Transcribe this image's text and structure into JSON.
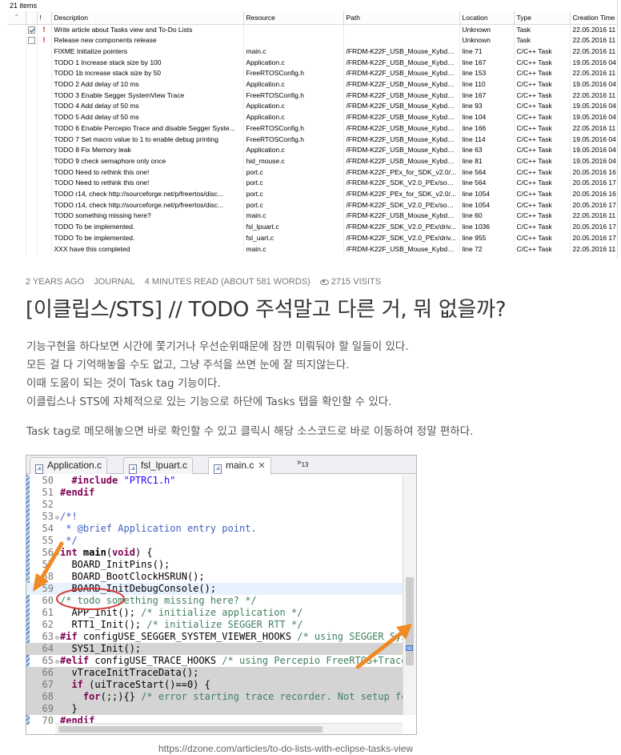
{
  "tasks_view": {
    "item_count": "21 items",
    "columns": [
      "Description",
      "Resource",
      "Path",
      "Location",
      "Type",
      "Creation Time"
    ],
    "rows": [
      {
        "checked": true,
        "priority": "!",
        "description": "Write article about Tasks view and To-Do Lists",
        "resource": "",
        "path": "",
        "location": "Unknown",
        "type": "Task",
        "created": "22.05.2016 11"
      },
      {
        "checked": false,
        "priority": "!",
        "description": "Release new components release",
        "resource": "",
        "path": "",
        "location": "Unknown",
        "type": "Task",
        "created": "22.05.2016 11"
      },
      {
        "checked": null,
        "priority": "",
        "description": "FIXME Initialize pointers",
        "resource": "main.c",
        "path": "/FRDM-K22F_USB_Mouse_Kybd_...",
        "location": "line 71",
        "type": "C/C++ Task",
        "created": "22.05.2016 11"
      },
      {
        "checked": null,
        "priority": "",
        "description": "TODO 1 Increase stack size by 100",
        "resource": "Application.c",
        "path": "/FRDM-K22F_USB_Mouse_Kybd_...",
        "location": "line 167",
        "type": "C/C++ Task",
        "created": "19.05.2016 04"
      },
      {
        "checked": null,
        "priority": "",
        "description": "TODO 1b increase stack size by 50",
        "resource": "FreeRTOSConfig.h",
        "path": "/FRDM-K22F_USB_Mouse_Kybd_...",
        "location": "line 153",
        "type": "C/C++ Task",
        "created": "22.05.2016 11"
      },
      {
        "checked": null,
        "priority": "",
        "description": "TODO 2 Add delay of 10 ms",
        "resource": "Application.c",
        "path": "/FRDM-K22F_USB_Mouse_Kybd_...",
        "location": "line 110",
        "type": "C/C++ Task",
        "created": "19.05.2016 04"
      },
      {
        "checked": null,
        "priority": "",
        "description": "TODO 3 Enable Segger SystemView Trace",
        "resource": "FreeRTOSConfig.h",
        "path": "/FRDM-K22F_USB_Mouse_Kybd_...",
        "location": "line 167",
        "type": "C/C++ Task",
        "created": "22.05.2016 11"
      },
      {
        "checked": null,
        "priority": "",
        "description": "TODO 4 Add delay of 50 ms",
        "resource": "Application.c",
        "path": "/FRDM-K22F_USB_Mouse_Kybd_...",
        "location": "line 93",
        "type": "C/C++ Task",
        "created": "19.05.2016 04"
      },
      {
        "checked": null,
        "priority": "",
        "description": "TODO 5 Add delay of 50 ms",
        "resource": "Application.c",
        "path": "/FRDM-K22F_USB_Mouse_Kybd_...",
        "location": "line 104",
        "type": "C/C++ Task",
        "created": "19.05.2016 04"
      },
      {
        "checked": null,
        "priority": "",
        "description": "TODO 6 Enable Percepio Trace and disable Segger Syste...",
        "resource": "FreeRTOSConfig.h",
        "path": "/FRDM-K22F_USB_Mouse_Kybd_...",
        "location": "line 166",
        "type": "C/C++ Task",
        "created": "22.05.2016 11"
      },
      {
        "checked": null,
        "priority": "",
        "description": "TODO 7 Set macro value to 1 to enable debug printing",
        "resource": "FreeRTOSConfig.h",
        "path": "/FRDM-K22F_USB_Mouse_Kybd_...",
        "location": "line 114",
        "type": "C/C++ Task",
        "created": "19.05.2016 04"
      },
      {
        "checked": null,
        "priority": "",
        "description": "TODO 8 Fix Memory leak",
        "resource": "Application.c",
        "path": "/FRDM-K22F_USB_Mouse_Kybd_...",
        "location": "line 63",
        "type": "C/C++ Task",
        "created": "19.05.2016 04"
      },
      {
        "checked": null,
        "priority": "",
        "description": "TODO 9 check semaphore only once",
        "resource": "hid_mouse.c",
        "path": "/FRDM-K22F_USB_Mouse_Kybd_...",
        "location": "line 81",
        "type": "C/C++ Task",
        "created": "19.05.2016 04"
      },
      {
        "checked": null,
        "priority": "",
        "description": "TODO Need to rethink this one!",
        "resource": "port.c",
        "path": "/FRDM-K22F_PEx_for_SDK_v2.0/...",
        "location": "line 564",
        "type": "C/C++ Task",
        "created": "20.05.2016 16"
      },
      {
        "checked": null,
        "priority": "",
        "description": "TODO Need to rethink this one!",
        "resource": "port.c",
        "path": "/FRDM-K22F_SDK_V2.0_PEx/sour...",
        "location": "line 564",
        "type": "C/C++ Task",
        "created": "20.05.2016 17"
      },
      {
        "checked": null,
        "priority": "",
        "description": "TODO r14, check http://sourceforge.net/p/freertos/disc...",
        "resource": "port.c",
        "path": "/FRDM-K22F_PEx_for_SDK_v2.0/...",
        "location": "line 1054",
        "type": "C/C++ Task",
        "created": "20.05.2016 16"
      },
      {
        "checked": null,
        "priority": "",
        "description": "TODO r14, check http://sourceforge.net/p/freertos/disc...",
        "resource": "port.c",
        "path": "/FRDM-K22F_SDK_V2.0_PEx/sour...",
        "location": "line 1054",
        "type": "C/C++ Task",
        "created": "20.05.2016 17"
      },
      {
        "checked": null,
        "priority": "",
        "description": "TODO something missing here?",
        "resource": "main.c",
        "path": "/FRDM-K22F_USB_Mouse_Kybd_...",
        "location": "line 60",
        "type": "C/C++ Task",
        "created": "22.05.2016 11"
      },
      {
        "checked": null,
        "priority": "",
        "description": "TODO To be implemented.",
        "resource": "fsl_lpuart.c",
        "path": "/FRDM-K22F_SDK_V2.0_PEx/driv...",
        "location": "line 1036",
        "type": "C/C++ Task",
        "created": "20.05.2016 17"
      },
      {
        "checked": null,
        "priority": "",
        "description": "TODO To be implemented.",
        "resource": "fsl_uart.c",
        "path": "/FRDM-K22F_SDK_V2.0_PEx/driv...",
        "location": "line 955",
        "type": "C/C++ Task",
        "created": "20.05.2016 17"
      },
      {
        "checked": null,
        "priority": "",
        "description": "XXX have this completed",
        "resource": "main.c",
        "path": "/FRDM-K22F_USB_Mouse_Kybd_...",
        "location": "line 72",
        "type": "C/C++ Task",
        "created": "22.05.2016 11"
      }
    ]
  },
  "article": {
    "meta": {
      "age": "2 YEARS AGO",
      "category": "JOURNAL",
      "read_time": "4 MINUTES READ (ABOUT 581 WORDS)",
      "visits": "2715 VISITS"
    },
    "title": "[이클립스/STS] // TODO 주석말고 다른 거, 뭐 없을까?",
    "paragraph1": [
      "기능구현을 하다보면 시간에 쫓기거나 우선순위때문에 잠깐 미뤄둬야 할 일들이 있다.",
      "모든 걸 다 기억해놓을 수도 없고, 그냥 주석을 쓰면 눈에 잘 띄지않는다.",
      "이때 도움이 되는 것이 Task tag 기능이다.",
      "이클립스나 STS에 자체적으로 있는 기능으로 하단에 Tasks 탭을 확인할 수 있다."
    ],
    "paragraph2": "Task tag로 메모해놓으면 바로 확인할 수 있고 클릭시 해당 소스코드로 바로 이동하여 정말 편하다.",
    "caption": "https://dzone.com/articles/to-do-lists-with-eclipse-tasks-view"
  },
  "editor": {
    "tabs": [
      {
        "label": "Application.c",
        "icon": "c-file-icon"
      },
      {
        "label": "fsl_lpuart.c",
        "icon": "c-file-icon"
      },
      {
        "label": "main.c",
        "icon": "c-file-icon",
        "active": true
      }
    ],
    "overflow": "»",
    "overflow_count": "13",
    "highlight_color": "#e8f2fe",
    "annotation_color": "#f08a24",
    "circle_color": "#d63a3a"
  }
}
